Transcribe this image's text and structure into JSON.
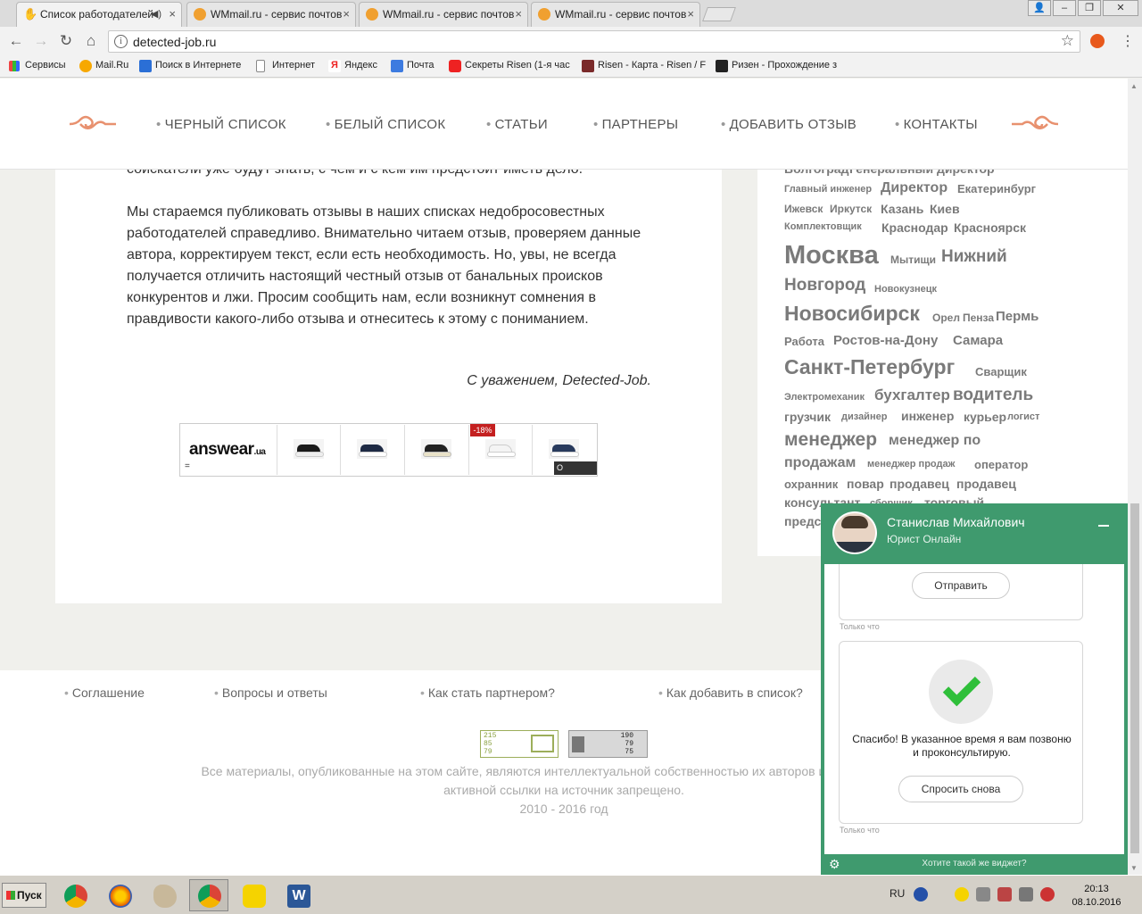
{
  "browser": {
    "tabs": [
      {
        "title": "Список работодателей",
        "active": true
      },
      {
        "title": "WMmail.ru - сервис почтов",
        "active": false
      },
      {
        "title": "WMmail.ru - сервис почтов",
        "active": false
      },
      {
        "title": "WMmail.ru - сервис почтов",
        "active": false
      }
    ],
    "url": "detected-job.ru",
    "bookmarks": [
      "Сервисы",
      "Mail.Ru",
      "Поиск в Интернете",
      "Интернет",
      "Яндекс",
      "Почта",
      "Секреты Risen (1-я час",
      "Risen - Карта - Risen / F",
      "Ризен - Прохождение з"
    ]
  },
  "nav": {
    "items": [
      "ЧЕРНЫЙ СПИСОК",
      "БЕЛЫЙ СПИСОК",
      "СТАТЬИ",
      "ПАРТНЕРЫ",
      "ДОБАВИТЬ ОТЗЫВ",
      "КОНТАКТЫ"
    ]
  },
  "article": {
    "partial_line": "соискатели уже будут знать, с чем и с кем им предстоит иметь дело.",
    "paragraph": "Мы стараемся публиковать отзывы в наших списках недобросовестных работодателей справедливо. Внимательно читаем отзыв, проверяем данные автора, корректируем текст, если есть необходимость. Но, увы, не всегда получается отличить настоящий честный отзыв от банальных происков конкурентов и лжи. Просим сообщить нам, если возникнут сомнения в правдивости какого-либо отзыва и отнеситесь к этому с пониманием.",
    "signature": "С уважением, Detected-Job."
  },
  "ad": {
    "brand": "answear",
    "brand_suffix": ".ua",
    "discount": "-18%",
    "about": "О ФИРМЕ"
  },
  "tags": [
    "Волгоград",
    "Генеральный директор",
    "Главный инженер",
    "Директор",
    "Екатеринбург",
    "Ижевск",
    "Иркутск",
    "Казань",
    "Киев",
    "Комплектовщик",
    "Краснодар",
    "Красноярск",
    "Москва",
    "Мытищи",
    "Нижний",
    "Новгород",
    "Новокузнецк",
    "Новосибирск",
    "Орел",
    "Пенза",
    "Пермь",
    "Работа",
    "Ростов-на-Дону",
    "Самара",
    "Санкт-Петербург",
    "Сварщик",
    "Электромеханик",
    "бухгалтер",
    "водитель",
    "грузчик",
    "дизайнер",
    "инженер",
    "курьер",
    "логист",
    "менеджер",
    "менеджер по",
    "продажам",
    "менеджер продаж",
    "оператор",
    "охранник",
    "повар",
    "продавец",
    "продавец",
    "консультант",
    "сборщик",
    "торговый",
    "предс"
  ],
  "footer": {
    "links": [
      "Соглашение",
      "Вопросы и ответы",
      "Как стать партнером?",
      "Как добавить в список?"
    ],
    "counter1": [
      "215",
      "85",
      "79"
    ],
    "counter2": [
      "190",
      "79",
      "75"
    ],
    "copyright": "Все материалы, опубликованные на этом сайте, являются интеллектуальной собственностью их авторов и редакторов прое\nактивной ссылки на источник запрещено.\n2010 - 2016 год"
  },
  "chat": {
    "agent_name": "Станислав Михайлович",
    "agent_role": "Юрист Онлайн",
    "send_label": "Отправить",
    "timestamp": "Только что",
    "thanks": "Спасибо! В указанное время я вам позвоню и проконсультирую.",
    "ask_again": "Спросить снова",
    "promo": "Хотите такой же виджет?"
  },
  "taskbar": {
    "start": "Пуск",
    "lang": "RU",
    "time": "20:13",
    "date": "08.10.2016"
  },
  "colors": {
    "accent_orange": "#e8916f",
    "chat_green": "#3f9a6e",
    "tag_gray": "#7a7a7a",
    "check_green": "#2fbf3a"
  }
}
